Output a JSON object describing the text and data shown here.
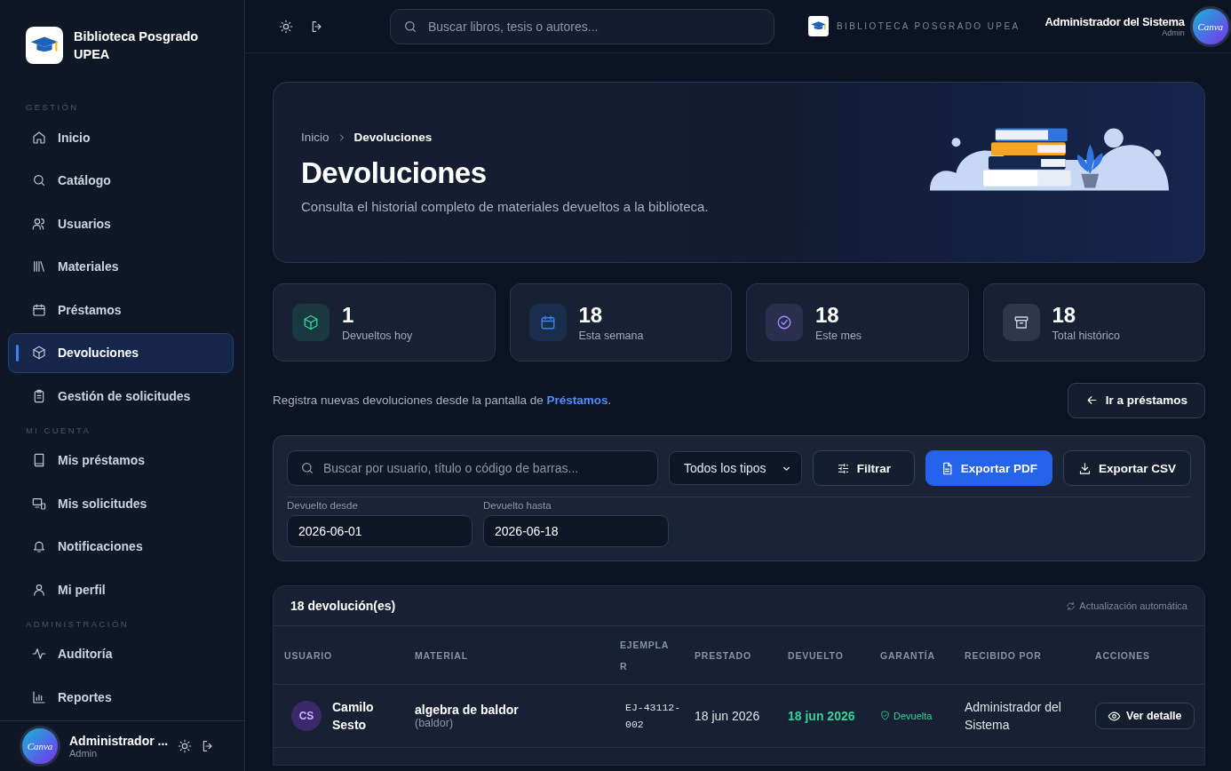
{
  "sidebar": {
    "brand": {
      "name": "Biblioteca Posgrado UPEA"
    },
    "sections": [
      {
        "title": "GESTIÓN",
        "items": [
          {
            "label": "Inicio",
            "selected": false
          },
          {
            "label": "Catálogo",
            "selected": false
          },
          {
            "label": "Usuarios",
            "selected": false
          },
          {
            "label": "Materiales",
            "selected": false
          },
          {
            "label": "Préstamos",
            "selected": false
          },
          {
            "label": "Devoluciones",
            "selected": true
          },
          {
            "label": "Gestión de solicitudes",
            "selected": false
          }
        ]
      },
      {
        "title": "MI CUENTA",
        "items": [
          {
            "label": "Mis préstamos",
            "selected": false
          },
          {
            "label": "Mis solicitudes",
            "selected": false
          },
          {
            "label": "Notificaciones",
            "selected": false
          },
          {
            "label": "Mi perfil",
            "selected": false
          }
        ]
      },
      {
        "title": "ADMINISTRACIÓN",
        "items": [
          {
            "label": "Auditoría",
            "selected": false
          },
          {
            "label": "Reportes",
            "selected": false
          }
        ]
      }
    ],
    "user": {
      "name": "Administrador ...",
      "role": "Admin",
      "avatar_text": "Canva"
    }
  },
  "topbar": {
    "search": {
      "placeholder": "Buscar libros, tesis o autores..."
    },
    "brand": "BIBLIOTECA POSGRADO UPEA",
    "user": {
      "name": "Administrador del Sistema",
      "role": "Admin",
      "avatar_text": "Canva"
    }
  },
  "hero": {
    "breadcrumb": [
      "Inicio",
      "Devoluciones"
    ],
    "title": "Devoluciones",
    "subtitle": "Consulta el historial completo de materiales devueltos a la biblioteca."
  },
  "stats": [
    {
      "value": "1",
      "label": "Devueltos hoy",
      "color": "#34d399"
    },
    {
      "value": "18",
      "label": "Esta semana",
      "color": "#3b82f6"
    },
    {
      "value": "18",
      "label": "Este mes",
      "color": "#a78bfa"
    },
    {
      "value": "18",
      "label": "Total histórico",
      "color": "#cbd5e1"
    }
  ],
  "notice": {
    "text": "Registra nuevas devoluciones desde la pantalla de ",
    "link": "Préstamos",
    "after": ".",
    "button": "Ir a préstamos"
  },
  "filters": {
    "search": {
      "placeholder": "Buscar por usuario, título o código de barras..."
    },
    "type_select": "Todos los tipos",
    "buttons": [
      {
        "label": "Filtrar",
        "kind": "outline"
      },
      {
        "label": "Exportar PDF",
        "kind": "primary"
      },
      {
        "label": "Exportar CSV",
        "kind": "outline"
      }
    ],
    "dates": [
      {
        "label": "Devuelto desde",
        "value": "2026-06-01"
      },
      {
        "label": "Devuelto hasta",
        "value": "2026-06-18"
      }
    ]
  },
  "table": {
    "count": "18 devolución(es)",
    "auto_refresh": "Actualización automática",
    "columns": [
      "USUARIO",
      "MATERIAL",
      "EJEMPLAR",
      "PRESTADO",
      "DEVUELTO",
      "GARANTÍA",
      "RECIBIDO POR",
      "ACCIONES"
    ],
    "rows": [
      {
        "initials": "CS",
        "user": "Camilo Sesto",
        "material": "algebra de baldor",
        "material_note": "(baldor)",
        "copy": "EJ-43112-002",
        "lent": "18 jun 2026",
        "returned": "18 jun 2026",
        "guarantee": "Devuelta",
        "received_by": "Administrador del Sistema",
        "action": "Ver detalle"
      }
    ]
  }
}
